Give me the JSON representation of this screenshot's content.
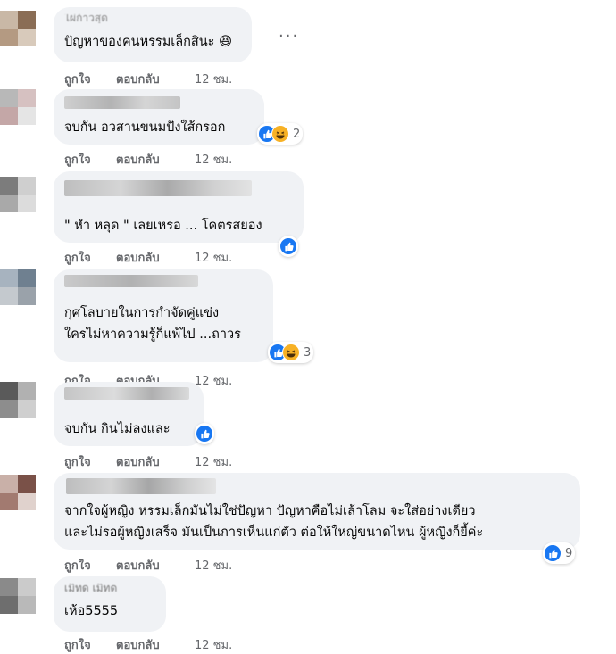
{
  "labels": {
    "like": "ถูกใจ",
    "reply": "ตอบกลับ",
    "time": "12 ชม."
  },
  "more_options": "···",
  "comments": [
    {
      "name": "ไผ่ก้าวสุด",
      "lines": [
        "ปัญหาของคนหรรมเล็กสินะ 😆"
      ],
      "reactions": {
        "icons": [
          "haha"
        ],
        "count": ""
      }
    },
    {
      "name": "",
      "lines": [
        "จบกัน อวสานขนมปังใส้กรอก"
      ],
      "reactions": {
        "icons": [
          "like",
          "haha"
        ],
        "count": "2"
      }
    },
    {
      "name": "",
      "lines": [
        "\" หำ หลุด \" เลยเหรอ ... โคตรสยอง"
      ],
      "reactions": {
        "icons": [
          "like"
        ],
        "count": ""
      }
    },
    {
      "name": "ไผ่ก",
      "lines": [
        "กุศโลบายในการกำจัดคู่แข่ง",
        "ใครไม่หาความรู้ก็แพ้ไป ...ถาวร"
      ],
      "reactions": {
        "icons": [
          "like",
          "haha"
        ],
        "count": "3"
      }
    },
    {
      "name": "",
      "lines": [
        "จบกัน กินไม่ลงและ"
      ],
      "reactions": {
        "icons": [
          "like"
        ],
        "count": ""
      }
    },
    {
      "name": "",
      "lines": [
        "จากใจผู้หญิง หรรมเล็กมันไม่ใช่ปัญหา ปัญหาคือไม่เล้าโลม จะใส่อย่างเดียว",
        "และไม่รอผู้หญิงเสร็จ มันเป็นการเห็นแก่ตัว ต่อให้ใหญ่ขนาดไหน ผู้หญิงก็ยี้ค่ะ"
      ],
      "reactions": {
        "icons": [
          "like"
        ],
        "count": "9"
      }
    },
    {
      "name": "เมิทด เมิทด",
      "lines": [
        "เห้อ5555"
      ],
      "reactions": {
        "icons": [],
        "count": ""
      }
    }
  ]
}
